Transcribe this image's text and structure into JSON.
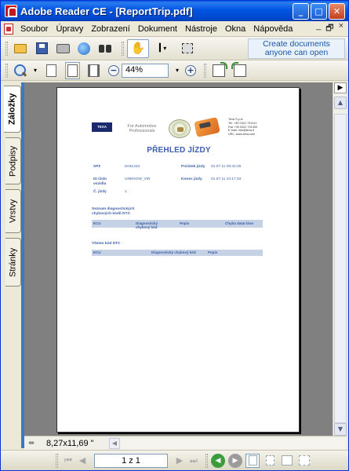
{
  "window": {
    "title": "Adobe Reader CE - [ReportTrip.pdf]",
    "btn_minimize": "_",
    "btn_maximize": "□",
    "btn_close": "✕"
  },
  "menu": {
    "items": [
      "Soubor",
      "Úpravy",
      "Zobrazení",
      "Dokument",
      "Nástroje",
      "Okna",
      "Nápověda"
    ],
    "right": [
      "_",
      "🗗",
      "×"
    ]
  },
  "toolbar": {
    "promo_line1": "Create documents",
    "promo_line2": "anyone can open",
    "zoom_value": "44%"
  },
  "nav_tabs": [
    "Záložky",
    "Podpisy",
    "Vrstvy",
    "Stránky"
  ],
  "document": {
    "brand": "TEXA",
    "tagline": "For Automotive Professionals",
    "company_lines": [
      "Texa S.p.A.",
      "Tel. +39 0422 791311",
      "Fax +39 0422 791300",
      "E-mail: info@texa.it",
      "URL: www.texa.com"
    ],
    "title": "PŘEHLED JÍZDY",
    "spz_label": "SPZ",
    "spz_value": "8A81443",
    "vin_label": "ID číslo vozidla",
    "vin_value": "UNKNOW_VIN",
    "trip_no_label": "Č. jízdy",
    "trip_no_value": "1",
    "start_label": "Počátek jízdy",
    "start_value": "01.07.11 09:42:25",
    "end_label": "Konec jízdy",
    "end_value": "01.07.11 10:17:34",
    "section1": "Seznam diagnostických chybových kódů DTC",
    "t1_cols": [
      "ECU",
      "Diagnostický chybový kód",
      "Popis",
      "Chyba datat láno"
    ],
    "section2": "Všeien kód DTC",
    "t2_cols": [
      "ECU",
      "Diagnostický chybový kód",
      "Popis"
    ]
  },
  "status": {
    "page_size": "8,27x11,69 \"",
    "page_indicator": "1 z 1"
  }
}
